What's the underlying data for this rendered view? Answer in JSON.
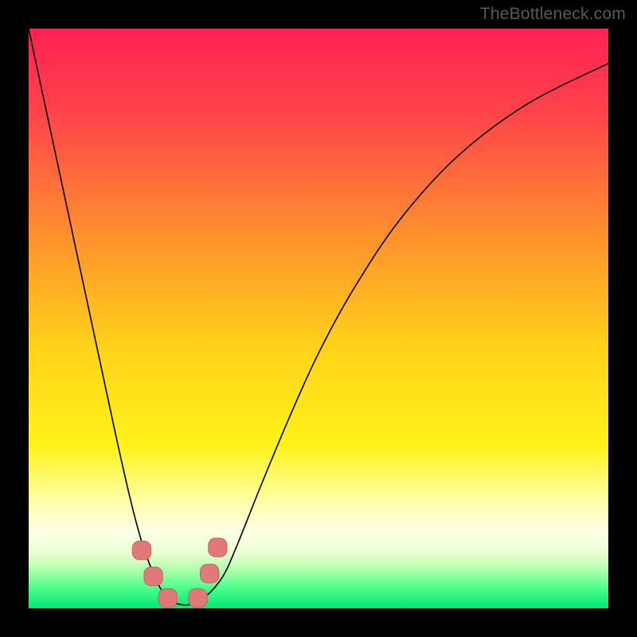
{
  "watermark": "TheBottleneck.com",
  "colors": {
    "frame": "#000000",
    "curve": "#000000",
    "marker_fill": "#e07a7a",
    "marker_stroke": "#c96060",
    "gradient_stops": [
      {
        "offset": 0.0,
        "color": "#ff2154"
      },
      {
        "offset": 0.15,
        "color": "#ff4549"
      },
      {
        "offset": 0.35,
        "color": "#ff8e2f"
      },
      {
        "offset": 0.55,
        "color": "#ffd21a"
      },
      {
        "offset": 0.72,
        "color": "#fff31a"
      },
      {
        "offset": 0.82,
        "color": "#ffffb0"
      },
      {
        "offset": 0.87,
        "color": "#ffffe6"
      },
      {
        "offset": 0.905,
        "color": "#e8ffd0"
      },
      {
        "offset": 0.93,
        "color": "#b8ffb0"
      },
      {
        "offset": 0.965,
        "color": "#4dff8a"
      },
      {
        "offset": 1.0,
        "color": "#00e874"
      }
    ]
  },
  "chart_data": {
    "type": "line",
    "title": "",
    "xlabel": "",
    "ylabel": "",
    "xlim": [
      0,
      1
    ],
    "ylim": [
      0,
      1
    ],
    "note": "Axes unlabeled in the original image. x in [0,1] spans plot width; y in [0,1] spans plot height with 0 at the bottom (green) and 1 at the top (red). Values estimated from pixel positions.",
    "series": [
      {
        "name": "curve",
        "x": [
          0.0,
          0.03,
          0.06,
          0.09,
          0.12,
          0.15,
          0.175,
          0.195,
          0.215,
          0.23,
          0.245,
          0.26,
          0.28,
          0.305,
          0.335,
          0.36,
          0.4,
          0.45,
          0.5,
          0.56,
          0.64,
          0.74,
          0.86,
          1.0
        ],
        "y": [
          1.0,
          0.86,
          0.72,
          0.58,
          0.44,
          0.3,
          0.19,
          0.115,
          0.06,
          0.03,
          0.013,
          0.007,
          0.007,
          0.02,
          0.055,
          0.11,
          0.21,
          0.33,
          0.44,
          0.55,
          0.67,
          0.78,
          0.87,
          0.94
        ]
      }
    ],
    "markers": [
      {
        "x": 0.195,
        "y": 0.1
      },
      {
        "x": 0.215,
        "y": 0.055
      },
      {
        "x": 0.24,
        "y": 0.018
      },
      {
        "x": 0.292,
        "y": 0.018
      },
      {
        "x": 0.312,
        "y": 0.06
      },
      {
        "x": 0.326,
        "y": 0.105
      }
    ],
    "marker_radius_frac": 0.016
  }
}
